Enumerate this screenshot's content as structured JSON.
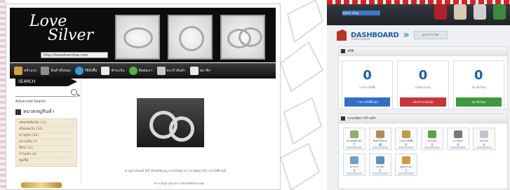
{
  "left_site": {
    "logo_line1": "Love",
    "logo_line2": "Silver",
    "logo_url": "http://lovesilvershop.com",
    "nav_items": [
      {
        "label": "หน้าแรก",
        "icon": "home-icon",
        "color": "#d3a13b"
      },
      {
        "label": "สินค้าทั้งหมด",
        "icon": "cart-icon",
        "color": "#8f8f8f"
      },
      {
        "label": "วิธีสั่งซื้อ",
        "icon": "globe-icon",
        "color": "#3b9ad8"
      },
      {
        "label": "ชำระเงิน",
        "icon": "card-icon",
        "color": "#eaeaea"
      },
      {
        "label": "ติดต่อเรา",
        "icon": "globe-icon",
        "color": "#53b24c"
      },
      {
        "label": "ตะกร้าสินค้า",
        "icon": "person-icon",
        "color": "#c9c9c9"
      },
      {
        "label": "สมาชิก",
        "icon": "house-icon",
        "color": "#eaeaea"
      }
    ],
    "search_heading": "SEARCH",
    "search_placeholder": "",
    "advanced_search": "Advanced Search",
    "category_heading": "หมวดหมู่สินค้า",
    "categories": [
      "สร้อยข้อมือเงิน (11)",
      "สร้อยคอเงิน (24)",
      "ต่างหูเงิน (30)",
      "แหวนเงิน (7)",
      "จี้เงิน (12)",
      "กำไลเงิน (4)",
      "ชุดเซ็ต"
    ],
    "product_caption": "ต่างหูห่วงเงินแท้ 925 ดีไซน์เรียบหรู สวมใส่ได้ทุกวัน ราคาพิเศษ 250 บาท สั่งซื้อวันนี้",
    "product_caption2": "ชำระเงินผ่านธนาคาร จัดส่งฟรีทั่วประเทศ"
  },
  "right_admin": {
    "user_name": "admin shop",
    "top_icons": [
      {
        "icon": "user-icon",
        "color": "#b3202a"
      },
      {
        "icon": "tools-icon",
        "color": "#d9c8b5"
      },
      {
        "icon": "cart-icon",
        "color": "#cfcfcf"
      },
      {
        "icon": "logout-icon",
        "color": "#3c8b3c"
      }
    ],
    "dashboard_title": "DASHBOARD",
    "dashboard_sub": "control panel",
    "view_site_button": "ดูหน้าเว็บไซต์",
    "stats_heading": "สถิติ",
    "stats": [
      {
        "value": "0",
        "label": "รายการสั่งซื้อ",
        "button": "รายการสั่งซื้อใหม่",
        "button_color": "#2f6fc6"
      },
      {
        "value": "0",
        "label": "แจ้งชำระเงิน",
        "button": "แจ้งชำระเงินใหม่",
        "button_color": "#c9343a"
      },
      {
        "value": "0",
        "label": "สมาชิกใหม่",
        "button": "สมาชิกใหม่",
        "button_color": "#3b9a3b"
      }
    ],
    "manage_heading": "ระบบจัดการร้านค้า",
    "tiles": [
      {
        "label": "หมวดหมู่สินค้า",
        "count": "7",
        "icon": "tree-icon",
        "color": "#8fae6f"
      },
      {
        "label": "สินค้าทั้งหมด",
        "count": "88",
        "icon": "box-icon",
        "color": "#b08b5a"
      },
      {
        "label": "รายการสั่งซื้อ",
        "count": "0",
        "icon": "clipboard-icon",
        "color": "#c49a4c"
      },
      {
        "label": "ชำระเงิน",
        "count": "0",
        "icon": "bag-icon",
        "color": "#5fa04a"
      },
      {
        "label": "การจัดส่ง",
        "count": "0",
        "icon": "truck-icon",
        "color": "#7a7a7a"
      },
      {
        "label": "หน้าเพจ",
        "count": "0",
        "icon": "page-icon",
        "color": "#bfc6cf"
      },
      {
        "label": "ข่าวสาร",
        "count": "0",
        "icon": "news-icon",
        "color": "#6aa0c9"
      },
      {
        "label": "สมาชิก",
        "count": "0",
        "icon": "member-icon",
        "color": "#5b8fbf"
      },
      {
        "label": "ผู้ดูแลระบบ",
        "count": "1",
        "icon": "admin-icon",
        "color": "#d09a3a"
      }
    ]
  }
}
